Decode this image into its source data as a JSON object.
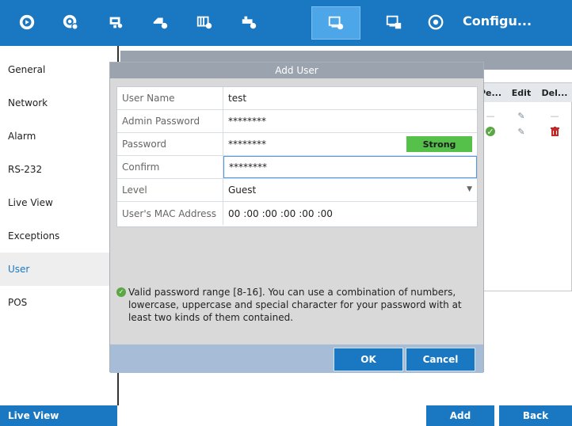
{
  "topbar": {
    "icons": [
      "playback-icon",
      "camera-settings-icon",
      "record-icon",
      "network-camera-icon",
      "storage-icon",
      "network-tools-icon",
      "system-config-icon",
      "maintenance-icon",
      "configuration-icon"
    ],
    "title": "Configu..."
  },
  "sidebar": {
    "items": [
      {
        "label": "General"
      },
      {
        "label": "Network"
      },
      {
        "label": "Alarm"
      },
      {
        "label": "RS-232"
      },
      {
        "label": "Live View"
      },
      {
        "label": "Exceptions"
      },
      {
        "label": "User"
      },
      {
        "label": "POS"
      }
    ],
    "active": "User"
  },
  "background_table": {
    "columns": [
      "Pe...",
      "Edit",
      "Del..."
    ]
  },
  "modal": {
    "title": "Add User",
    "fields": {
      "user_name": {
        "label": "User Name",
        "value": "test"
      },
      "admin_password": {
        "label": "Admin Password",
        "value": "********"
      },
      "password": {
        "label": "Password",
        "value": "********",
        "strength": "Strong"
      },
      "confirm": {
        "label": "Confirm",
        "value": "********"
      },
      "level": {
        "label": "Level",
        "value": "Guest"
      },
      "mac": {
        "label": "User's MAC Address",
        "parts": [
          "00",
          ":00",
          ":00",
          ":00",
          ":00",
          ":00"
        ]
      }
    },
    "hint": "Valid password range [8-16]. You can use a combination of numbers, lowercase, uppercase and special character for your password with at least two kinds of them contained.",
    "ok_label": "OK",
    "cancel_label": "Cancel"
  },
  "bottom": {
    "live_view": "Live View",
    "add": "Add",
    "back": "Back"
  },
  "colors": {
    "brand": "#1a78c2",
    "active_tab": "#4da6e8",
    "strong": "#55c04a"
  }
}
